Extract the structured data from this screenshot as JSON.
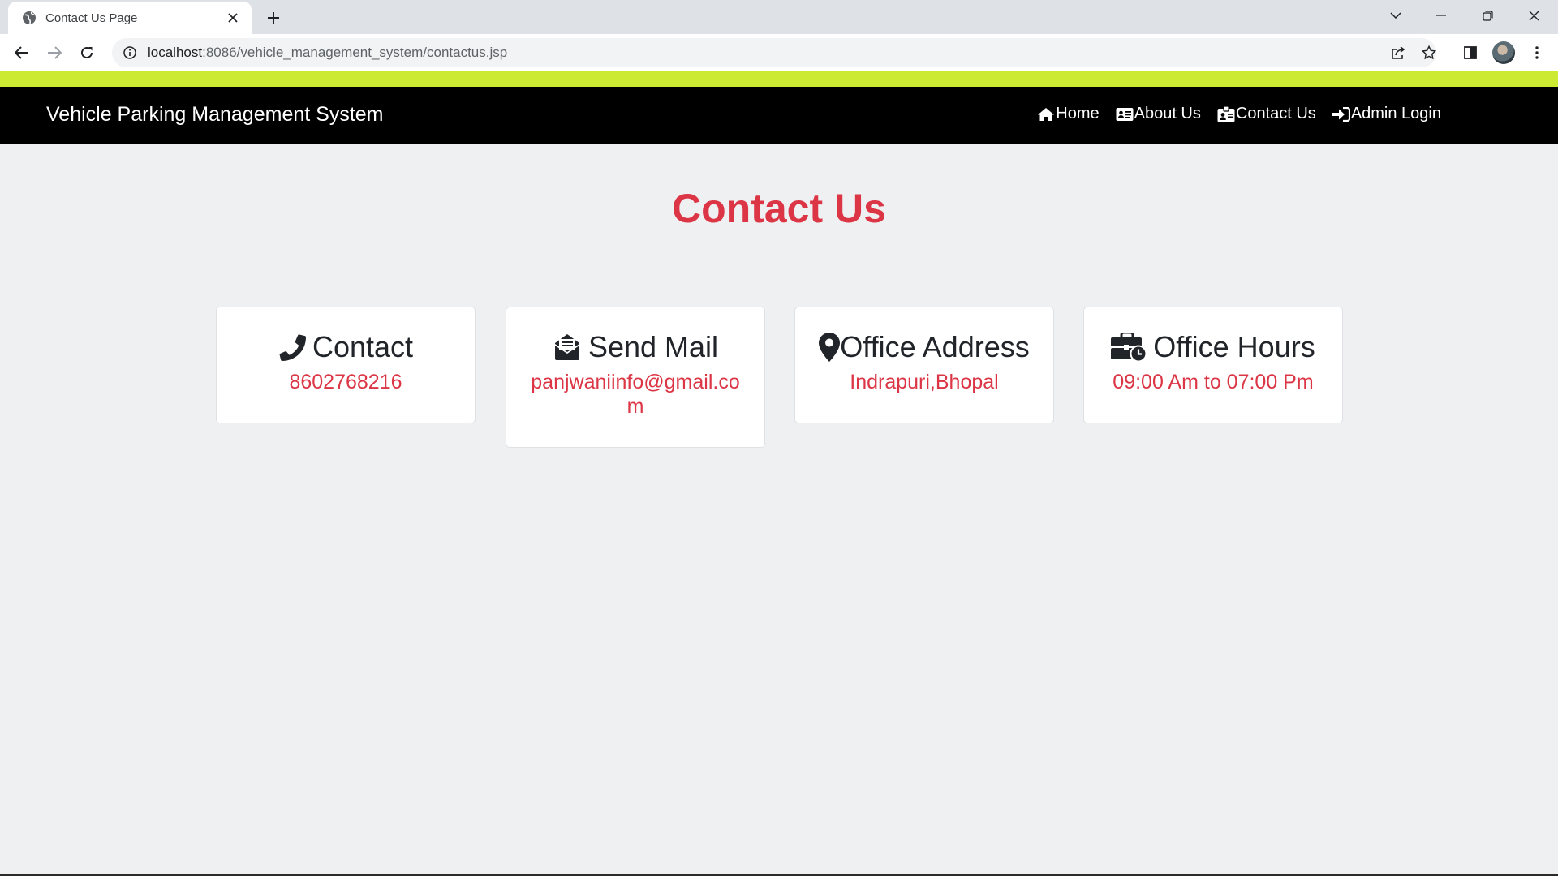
{
  "browser": {
    "tab_title": "Contact Us Page",
    "url_host": "localhost",
    "url_rest": ":8086/vehicle_management_system/contactus.jsp"
  },
  "site": {
    "brand": "Vehicle Parking Management System",
    "nav": [
      {
        "label": "Home",
        "icon": "home-icon"
      },
      {
        "label": "About Us",
        "icon": "id-card-icon"
      },
      {
        "label": "Contact Us",
        "icon": "id-badge-icon"
      },
      {
        "label": "Admin Login",
        "icon": "sign-in-icon"
      }
    ],
    "accent_color": "#cdea33"
  },
  "main": {
    "title": "Contact Us",
    "title_color": "#dc3545",
    "cards": [
      {
        "title": "Contact",
        "value": "8602768216",
        "icon": "phone-icon"
      },
      {
        "title": "Send Mail",
        "value": "panjwaniinfo@gmail.com",
        "icon": "envelope-open-icon"
      },
      {
        "title": "Office Address",
        "value": "Indrapuri,Bhopal",
        "icon": "map-marker-icon"
      },
      {
        "title": "Office Hours",
        "value": "09:00 Am to 07:00 Pm",
        "icon": "business-time-icon"
      }
    ]
  }
}
